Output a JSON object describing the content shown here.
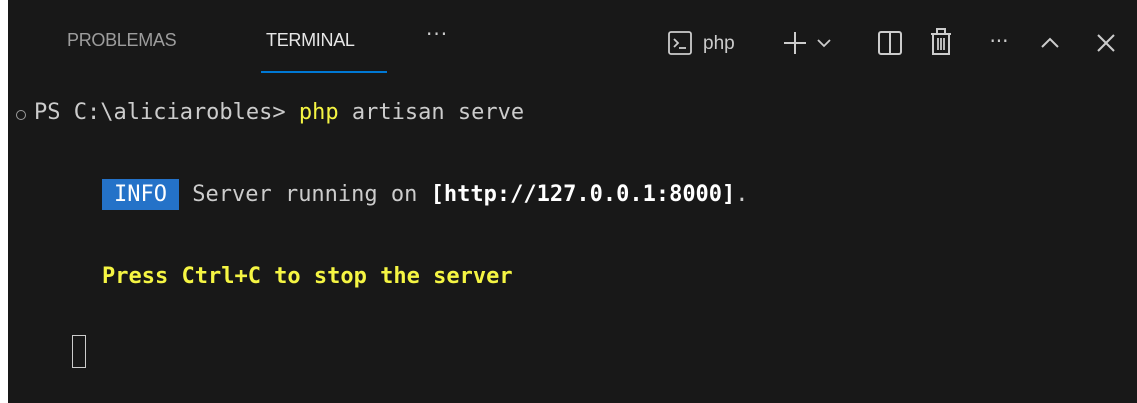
{
  "tabs": {
    "problems_label": "PROBLEMAS",
    "terminal_label": "TERMINAL",
    "more_label": "···"
  },
  "toolbar": {
    "shell_label": "php",
    "more_actions_label": "···",
    "icons": [
      "terminal-shell-icon",
      "plus-icon",
      "chevron-down-icon",
      "split-terminal-icon",
      "trash-icon",
      "ellipsis-icon",
      "chevron-up-icon",
      "close-icon"
    ]
  },
  "terminal": {
    "prompt": "PS C:\\aliciarobles> ",
    "command_keyword": "php",
    "command_rest": " artisan serve",
    "info_badge": "INFO",
    "info_text": " Server running on ",
    "info_url": "[http://127.0.0.1:8000]",
    "info_end": ".",
    "stop_hint": "Press Ctrl+C to stop the server"
  },
  "colors": {
    "background": "#181818",
    "accent": "#0078d4",
    "yellow": "#f5f543",
    "info_blue": "#2472c8"
  }
}
